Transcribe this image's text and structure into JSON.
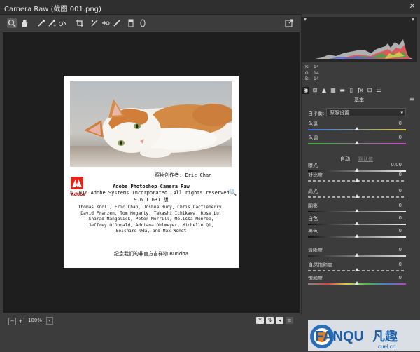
{
  "window": {
    "title": "Camera Raw (截图 001.png)"
  },
  "toolbar": {
    "tools": [
      {
        "name": "zoom-tool-icon",
        "glyph": "🔍"
      },
      {
        "name": "hand-tool-icon",
        "glyph": "✋"
      },
      {
        "name": "white-balance-tool-icon",
        "glyph": "✎"
      },
      {
        "name": "color-sampler-tool-icon",
        "glyph": "✎"
      },
      {
        "name": "targeted-adjustment-tool-icon",
        "glyph": "⊗"
      },
      {
        "name": "crop-tool-icon",
        "glyph": "⌗"
      },
      {
        "name": "straighten-tool-icon",
        "glyph": "⟋"
      },
      {
        "name": "spot-removal-tool-icon",
        "glyph": "✚"
      },
      {
        "name": "brush-tool-icon",
        "glyph": "/"
      },
      {
        "name": "graduated-filter-icon",
        "glyph": "▭"
      },
      {
        "name": "radial-filter-icon",
        "glyph": "○"
      }
    ],
    "export_icon": "⇪"
  },
  "splash": {
    "credit": "照片创作者: Eric Chan",
    "logo_text": "Adobe",
    "product": "Adobe Photoshop Camera Raw",
    "copyright": "© 2016 Adobe Systems Incorporated. All rights reserved.",
    "version": "9.6.1.631 版",
    "names": [
      "Thomas Knoll, Eric Chan, Joshua Bury, Chris Cactleberry,",
      "David Franzen, Tom Hogarty, Takashi Ichikawa, Rose Lu,",
      "Sharad Mangalick, Peter Merrill, Melissa Monroe,",
      "Jeffrey O'Donald, Adriana Ohlmeyer, Michelle Qi,",
      "Eoichiro Uda, and Max Wendt"
    ],
    "dedication": "纪念我们的非官方吉祥物 Buddha"
  },
  "bottom": {
    "zoom": "100%"
  },
  "histogram": {
    "r": "14",
    "g": "14",
    "b": "14"
  },
  "panel": {
    "section_title": "基本",
    "wb_label": "白平衡:",
    "wb_value": "原照设置",
    "auto_label": "自动",
    "default_label": "默认值",
    "rows": [
      {
        "label": "色温",
        "value": "0"
      },
      {
        "label": "色调",
        "value": "0"
      },
      {
        "label": "曝光",
        "value": "0.00"
      },
      {
        "label": "对比度",
        "value": "0"
      },
      {
        "label": "高光",
        "value": "0"
      },
      {
        "label": "阴影",
        "value": "0"
      },
      {
        "label": "白色",
        "value": "0"
      },
      {
        "label": "黑色",
        "value": "0"
      },
      {
        "label": "清晰度",
        "value": "0"
      },
      {
        "label": "自然饱和度",
        "value": "0"
      },
      {
        "label": "饱和度",
        "value": "0"
      }
    ]
  },
  "watermark": {
    "brand": "FANQU",
    "brand_cn": "凡趣",
    "url": "cuel.cn"
  }
}
